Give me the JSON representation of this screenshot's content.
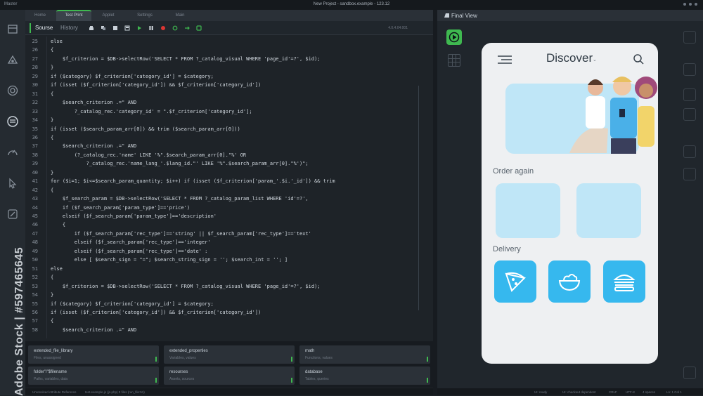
{
  "window": {
    "app_name": "Master",
    "title": "New Project - sandbox.example - 123.12"
  },
  "tabs": [
    "Home",
    "Test Print",
    "Applet",
    "Settings",
    "Main"
  ],
  "toolbar": {
    "source_label": "Sourse",
    "history_label": "History",
    "version": "4.0.4.04.001"
  },
  "code_lines": [
    {
      "num": "25",
      "code": "else"
    },
    {
      "num": "26",
      "code": "{"
    },
    {
      "num": "27",
      "code": "    $f_criterion = $DB->selectRow('SELECT * FROM ?_catalog_visual WHERE 'page_id'=?', $id);"
    },
    {
      "num": "28",
      "code": "}"
    },
    {
      "num": "29",
      "code": "if ($category) $f_criterion['category_id'] = $category;"
    },
    {
      "num": "30",
      "code": "if (isset ($f_criterion['category_id']) && $f_criterion['category_id'])"
    },
    {
      "num": "31",
      "code": "{"
    },
    {
      "num": "32",
      "code": "    $search_criterion .=\" AND"
    },
    {
      "num": "33",
      "code": "        ?_catalog_rec.'category_id' = \".$f_criterion['category_id'];"
    },
    {
      "num": "34",
      "code": "}"
    },
    {
      "num": "35",
      "code": "if (isset ($search_param_arr[0]) && trim ($search_param_arr[0]))"
    },
    {
      "num": "36",
      "code": "{"
    },
    {
      "num": "37",
      "code": "    $search_criterion .=\" AND"
    },
    {
      "num": "38",
      "code": "        (?_catalog_rec.'name' LIKE '%\".$search_param_arr[0].\"%' OR"
    },
    {
      "num": "39",
      "code": "            ?_catalog_rec.'name_lang_'.$lang_id.\"' LIKE '%\".$search_param_arr[0].\"%')\";"
    },
    {
      "num": "40",
      "code": "}"
    },
    {
      "num": "41",
      "code": "for ($i=1; $i<=$search_param_quantity; $i++) if (isset ($f_criterion['param_'.$i.'_id']) && trim"
    },
    {
      "num": "42",
      "code": "{"
    },
    {
      "num": "43",
      "code": "    $f_search_param = $DB->selectRow('SELECT * FROM ?_catalog_param_list WHERE 'id'=?',"
    },
    {
      "num": "44",
      "code": "    if ($f_search_param['param_type']=='price')"
    },
    {
      "num": "45",
      "code": "    elseif ($f_search_param['param_type']=='description'"
    },
    {
      "num": "46",
      "code": "    {"
    },
    {
      "num": "47",
      "code": "        if ($f_search_param['rec_type']=='string' || $f_search_param['rec_type']=='text'"
    },
    {
      "num": "48",
      "code": "        elseif ($f_search_param['rec_type']=='integer'"
    },
    {
      "num": "49",
      "code": "        elseif ($f_search_param['rec_type']=='date' :"
    },
    {
      "num": "50",
      "code": "        else [ $search_sign = \"=\"; $search_string_sign = ''; $search_int = ''; ]"
    },
    {
      "num": "51",
      "code": "else"
    },
    {
      "num": "52",
      "code": "{"
    },
    {
      "num": "53",
      "code": "    $f_criterion = $DB->selectRow('SELECT * FROM ?_catalog_visual WHERE 'page_id'=?', $id);"
    },
    {
      "num": "54",
      "code": "}"
    },
    {
      "num": "55",
      "code": "if ($category) $f_criterion['category_id'] = $category;"
    },
    {
      "num": "56",
      "code": "if (isset ($f_criterion['category_id']) && $f_criterion['category_id'])"
    },
    {
      "num": "57",
      "code": "{"
    },
    {
      "num": "58",
      "code": "    $search_criterion .=\" AND"
    }
  ],
  "bottom_cards": [
    {
      "label": "extended_file_library",
      "sub": "Files, unassigned"
    },
    {
      "label": "extended_properties",
      "sub": "Variables, values"
    },
    {
      "label": "math",
      "sub": "Functions, values"
    },
    {
      "label": "folder\"/\"$filename",
      "sub": "Paths, variables, data"
    },
    {
      "label": "resourses",
      "sub": "Assets, sources"
    },
    {
      "label": "database",
      "sub": "Tables, queries"
    }
  ],
  "status_bar": [
    "Unresolved Attribute Reference",
    "test.example.js (js-php) 0 files (run_file:51)",
    "UI: ready",
    "UI: checkout dependent",
    "CRLF",
    "UTF-8",
    "4 spaces",
    "Ln: 1 Col 1"
  ],
  "preview": {
    "header": "Final View",
    "screen_title": "Discover",
    "order_again": "Order again",
    "delivery": "Delivery"
  },
  "colors": {
    "accent": "#3fb950",
    "phone_card": "#bfe6f7",
    "category_button": "#36b8ee"
  },
  "watermark": {
    "text": "Adobe Stock",
    "id": "Adobe Stock | #597465645"
  }
}
